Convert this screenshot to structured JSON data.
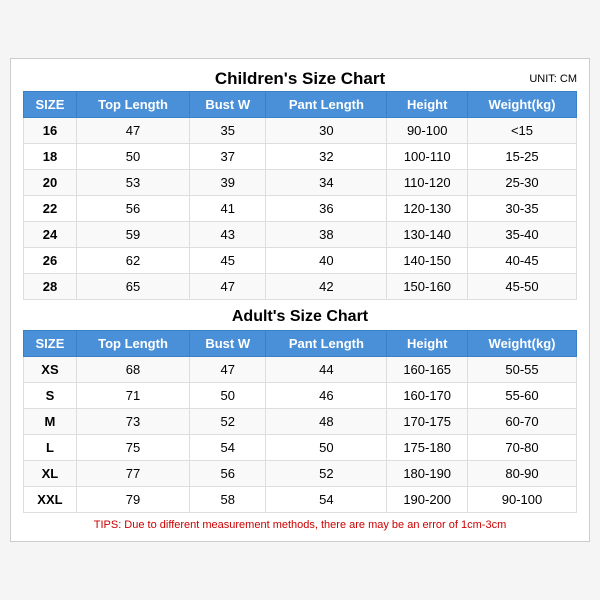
{
  "children_title": "Children's Size Chart",
  "adults_title": "Adult's Size Chart",
  "unit": "UNIT: CM",
  "headers": [
    "SIZE",
    "Top Length",
    "Bust W",
    "Pant Length",
    "Height",
    "Weight(kg)"
  ],
  "children_rows": [
    [
      "16",
      "47",
      "35",
      "30",
      "90-100",
      "<15"
    ],
    [
      "18",
      "50",
      "37",
      "32",
      "100-110",
      "15-25"
    ],
    [
      "20",
      "53",
      "39",
      "34",
      "110-120",
      "25-30"
    ],
    [
      "22",
      "56",
      "41",
      "36",
      "120-130",
      "30-35"
    ],
    [
      "24",
      "59",
      "43",
      "38",
      "130-140",
      "35-40"
    ],
    [
      "26",
      "62",
      "45",
      "40",
      "140-150",
      "40-45"
    ],
    [
      "28",
      "65",
      "47",
      "42",
      "150-160",
      "45-50"
    ]
  ],
  "adult_rows": [
    [
      "XS",
      "68",
      "47",
      "44",
      "160-165",
      "50-55"
    ],
    [
      "S",
      "71",
      "50",
      "46",
      "160-170",
      "55-60"
    ],
    [
      "M",
      "73",
      "52",
      "48",
      "170-175",
      "60-70"
    ],
    [
      "L",
      "75",
      "54",
      "50",
      "175-180",
      "70-80"
    ],
    [
      "XL",
      "77",
      "56",
      "52",
      "180-190",
      "80-90"
    ],
    [
      "XXL",
      "79",
      "58",
      "54",
      "190-200",
      "90-100"
    ]
  ],
  "tips": "TIPS: Due to different measurement methods, there are may be an error of 1cm-3cm"
}
